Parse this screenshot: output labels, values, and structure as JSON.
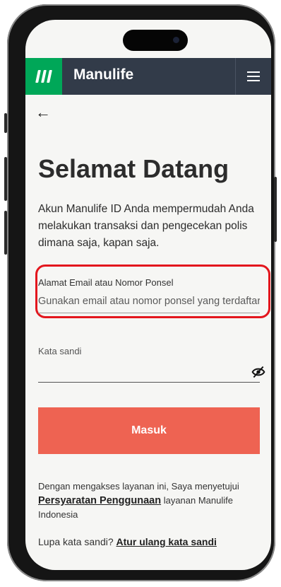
{
  "header": {
    "brand": "Manulife",
    "logo_icon": "manulife-logo-icon",
    "menu_icon": "hamburger-menu-icon",
    "brand_color": "#00a758",
    "bar_color": "#323b49"
  },
  "nav": {
    "back_icon": "back-arrow-icon",
    "back_glyph": "←"
  },
  "main": {
    "title": "Selamat Datang",
    "intro": "Akun Manulife ID Anda mempermudah Anda melakukan transaksi dan pengecekan polis dimana saja, kapan saja."
  },
  "form": {
    "email_label": "Alamat Email atau Nomor Ponsel",
    "email_placeholder": "Gunakan email atau nomor ponsel yang terdaftar",
    "email_value": "",
    "password_label": "Kata sandi",
    "password_value": "",
    "password_toggle_icon": "eye-slash-icon",
    "submit_label": "Masuk",
    "submit_color": "#ee6352",
    "highlight_color": "#e3161d"
  },
  "footer": {
    "terms_prefix": "Dengan mengakses layanan ini, Saya menyetujui",
    "terms_link": "Persyaratan Penggunaan",
    "terms_suffix": "layanan Manulife Indonesia",
    "forgot_prefix": "Lupa kata sandi?",
    "forgot_link": "Atur ulang kata sandi"
  }
}
